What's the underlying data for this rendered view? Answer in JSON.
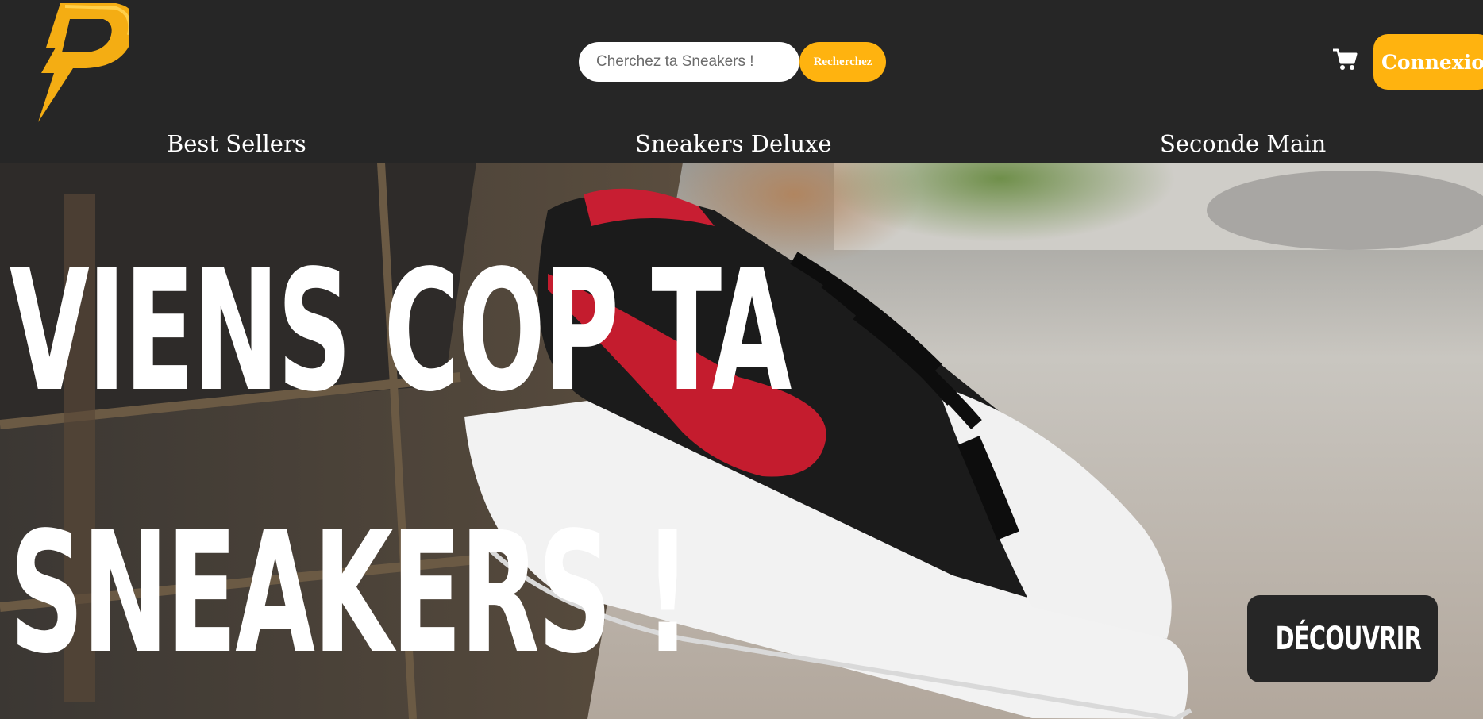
{
  "header": {
    "logo_alt": "P",
    "search": {
      "placeholder": "Cherchez ta Sneakers !",
      "value": "",
      "button_label": "Recherchez"
    },
    "cart_icon": "shopping-cart-icon",
    "login_label": "Connexion"
  },
  "nav": {
    "items": [
      {
        "label": "Best Sellers"
      },
      {
        "label": "Sneakers Deluxe"
      },
      {
        "label": "Seconde Main"
      }
    ]
  },
  "hero": {
    "headline_line1": "VIENS COP TA",
    "headline_line2": "SNEAKERS !",
    "cta_label": "DÉCOUVRIR",
    "image": "sneaker-hero-image"
  },
  "colors": {
    "background": "#262626",
    "accent": "#ffb30f",
    "text": "#ffffff"
  }
}
